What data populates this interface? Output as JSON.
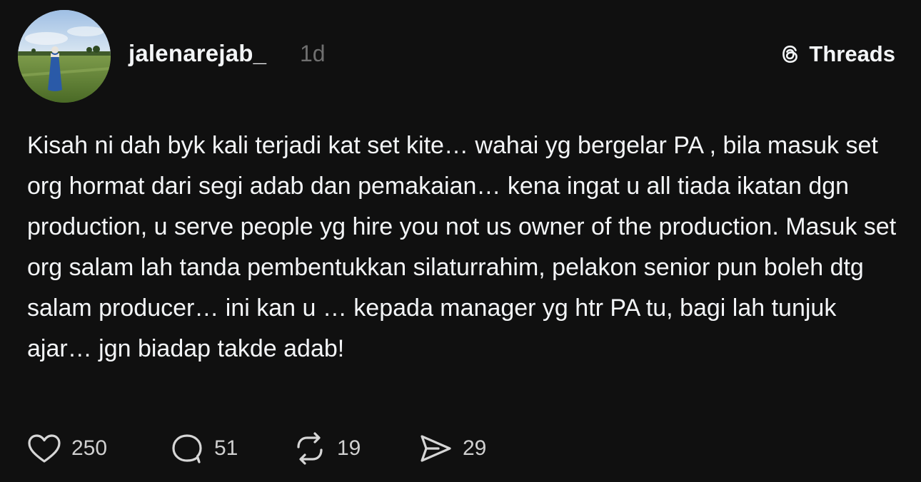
{
  "post": {
    "username": "jalenarejab_",
    "time": "1d",
    "brand": {
      "icon": "threads-logo-icon",
      "label": "Threads"
    },
    "text": "Kisah ni dah byk kali terjadi kat set kite… wahai yg bergelar PA , bila masuk set org hormat dari segi adab dan pemakaian… kena ingat u all tiada ikatan dgn production, u serve people yg hire you not us owner of the production. Masuk set org salam lah tanda pembentukkan silaturrahim, pelakon senior pun boleh dtg salam producer… ini kan u … kepada manager yg htr PA tu, bagi lah tunjuk ajar… jgn biadap takde adab!",
    "actions": {
      "likes": "250",
      "comments": "51",
      "reposts": "19",
      "shares": "29"
    }
  },
  "colors": {
    "background": "#101010",
    "text": "#f3f5f7",
    "muted": "#6f6f6f"
  }
}
